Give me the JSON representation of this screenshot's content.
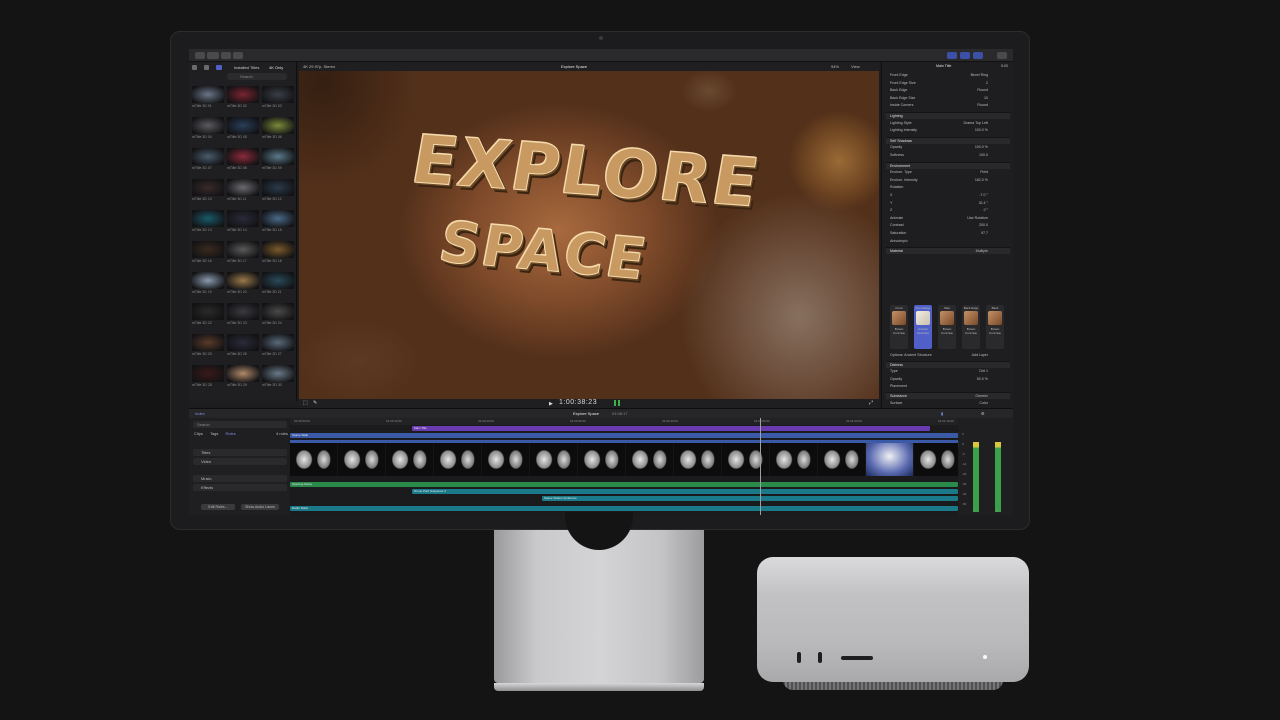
{
  "toolbar": {
    "left_buttons": 4,
    "right_buttons": 3
  },
  "browser": {
    "source": "Installed Titles",
    "filter": "4K Only",
    "search_placeholder": "Search",
    "thumbnails": [
      {
        "label": "mTitle 3D 01",
        "color": "#6a7688"
      },
      {
        "label": "mTitle 3D 02",
        "color": "#7a2430"
      },
      {
        "label": "mTitle 3D 03",
        "color": "#3a3e48"
      },
      {
        "label": "mTitle 3D 04",
        "color": "#5a5a60"
      },
      {
        "label": "mTitle 3D 05",
        "color": "#2a3e5a"
      },
      {
        "label": "mTitle 3D 06",
        "color": "#7a8a3a"
      },
      {
        "label": "mTitle 3D 07",
        "color": "#4a5a6a"
      },
      {
        "label": "mTitle 3D 08",
        "color": "#8a2a3a"
      },
      {
        "label": "mTitle 3D 09",
        "color": "#5a7a8a"
      },
      {
        "label": "mTitle 3D 10",
        "color": "#3a2a2a"
      },
      {
        "label": "mTitle 3D 11",
        "color": "#6a6a70"
      },
      {
        "label": "mTitle 3D 12",
        "color": "#2a3a4a"
      },
      {
        "label": "mTitle 3D 13",
        "color": "#1a5a6a"
      },
      {
        "label": "mTitle 3D 14",
        "color": "#2a2a3a"
      },
      {
        "label": "mTitle 3D 15",
        "color": "#4a6a8a"
      },
      {
        "label": "mTitle 3D 16",
        "color": "#3a2a20"
      },
      {
        "label": "mTitle 3D 17",
        "color": "#5a5a5a"
      },
      {
        "label": "mTitle 3D 18",
        "color": "#7a5a2a"
      },
      {
        "label": "mTitle 3D 19",
        "color": "#8a9ab0"
      },
      {
        "label": "mTitle 3D 20",
        "color": "#9a7a4a"
      },
      {
        "label": "mTitle 3D 21",
        "color": "#2a4a5a"
      },
      {
        "label": "mTitle 3D 22",
        "color": "#2a2a2a"
      },
      {
        "label": "mTitle 3D 23",
        "color": "#3a3a40"
      },
      {
        "label": "mTitle 3D 24",
        "color": "#4a4a4a"
      },
      {
        "label": "mTitle 3D 25",
        "color": "#5a3a2a"
      },
      {
        "label": "mTitle 3D 26",
        "color": "#2a2a3a"
      },
      {
        "label": "mTitle 3D 27",
        "color": "#5a6a7a"
      },
      {
        "label": "mTitle 3D 28",
        "color": "#3a1a1a"
      },
      {
        "label": "mTitle 3D 29",
        "color": "#b08a6a"
      },
      {
        "label": "mTitle 3D 30",
        "color": "#6a7a8a"
      }
    ]
  },
  "viewer": {
    "format": "4K 29.97p, Stereo",
    "title": "Explore Space",
    "zoom": "94%",
    "view_menu": "View",
    "overlay_line1": "EXPLORE",
    "overlay_line2": "SPACE",
    "timecode": "1:00:38:23"
  },
  "inspector": {
    "header": "Main Title",
    "duration": "5:00",
    "rows": [
      {
        "label": "Front Edge",
        "value": "Bevel Ring"
      },
      {
        "label": "Front Edge Size",
        "value": "2"
      },
      {
        "label": "Back Edge",
        "value": "Round"
      },
      {
        "label": "Back Edge Size",
        "value": "10"
      },
      {
        "label": "Inside Corners",
        "value": "Round"
      },
      {
        "label": "Lighting",
        "value": "",
        "section": true
      },
      {
        "label": "Lighting Style",
        "value": "Drama Top Left"
      },
      {
        "label": "Lighting Intensity",
        "value": "100.0 %"
      },
      {
        "label": "Self Shadows",
        "value": "",
        "section": true
      },
      {
        "label": "Opacity",
        "value": "100.0 %"
      },
      {
        "label": "Softness",
        "value": "100.0"
      },
      {
        "label": "Environment",
        "value": "",
        "section": true
      },
      {
        "label": "Environ. Type",
        "value": "Field"
      },
      {
        "label": "Environ. Intensity",
        "value": "182.0 %"
      },
      {
        "label": "Rotation",
        "value": ""
      },
      {
        "label": "X",
        "value": "-7.0 °"
      },
      {
        "label": "Y",
        "value": "32.4 °"
      },
      {
        "label": "Z",
        "value": "0 °"
      },
      {
        "label": "Animate",
        "value": "Use Rotation"
      },
      {
        "label": "Contrast",
        "value": "200.0"
      },
      {
        "label": "Saturation",
        "value": "97.7"
      },
      {
        "label": "Anisotropic",
        "value": ""
      },
      {
        "label": "Material",
        "value": "Multiple",
        "section": true
      }
    ],
    "materials": [
      {
        "name": "Front",
        "label": "Brown Concrete"
      },
      {
        "name": "Front Edge",
        "label": "Ancient Structure",
        "selected": true
      },
      {
        "name": "Side",
        "label": "Brown Concrete"
      },
      {
        "name": "Back Edge",
        "label": "Brown Concrete"
      },
      {
        "name": "Back",
        "label": "Brown Concrete"
      }
    ],
    "rows2": [
      {
        "label": "Options: Ancient Structure",
        "value": "Add Layer"
      },
      {
        "label": "Distress",
        "value": "",
        "section": true
      },
      {
        "label": "Type",
        "value": "Dirt 1"
      },
      {
        "label": "Opacity",
        "value": "50.0 %"
      },
      {
        "label": "Placement",
        "value": ""
      },
      {
        "label": "Substance",
        "value": "Generic",
        "section": true
      },
      {
        "label": "Surface",
        "value": "Color"
      },
      {
        "label": "Color",
        "value": ""
      },
      {
        "label": "Brightness",
        "value": "88.75 %"
      },
      {
        "label": "Opacity",
        "value": "100.0 %"
      },
      {
        "label": "Glow",
        "value": "",
        "section": true
      },
      {
        "label": "Drop Shadow",
        "value": "",
        "section": true
      }
    ]
  },
  "timeline": {
    "index_label": "Index",
    "project": "Explore Space",
    "project_duration": "01:08:17",
    "search_placeholder": "Search",
    "tabs": [
      "Clips",
      "Tags",
      "Roles"
    ],
    "role_count": "4 roles",
    "roles": [
      "Titles",
      "Video",
      "Music",
      "Effects"
    ],
    "buttons": [
      "Edit Roles...",
      "Show Audio Lanes"
    ],
    "ruler": [
      "01:00:00:00",
      "01:00:10:00",
      "01:00:20:00",
      "01:00:30:00",
      "01:00:40:00",
      "01:00:50:00",
      "01:01:00:00",
      "01:01:10:00"
    ],
    "title_clip": "Main Title",
    "video_clip": "Space Walk",
    "audio_clips": [
      "Opening Score",
      "Drone Park Suspense 3",
      "Space Station Ambience",
      "Radio Static"
    ],
    "meter_scale": [
      "6",
      "0",
      "-6",
      "-12",
      "-20",
      "-30",
      "-40",
      "-50"
    ],
    "meter_channels": [
      "L",
      "R"
    ]
  }
}
